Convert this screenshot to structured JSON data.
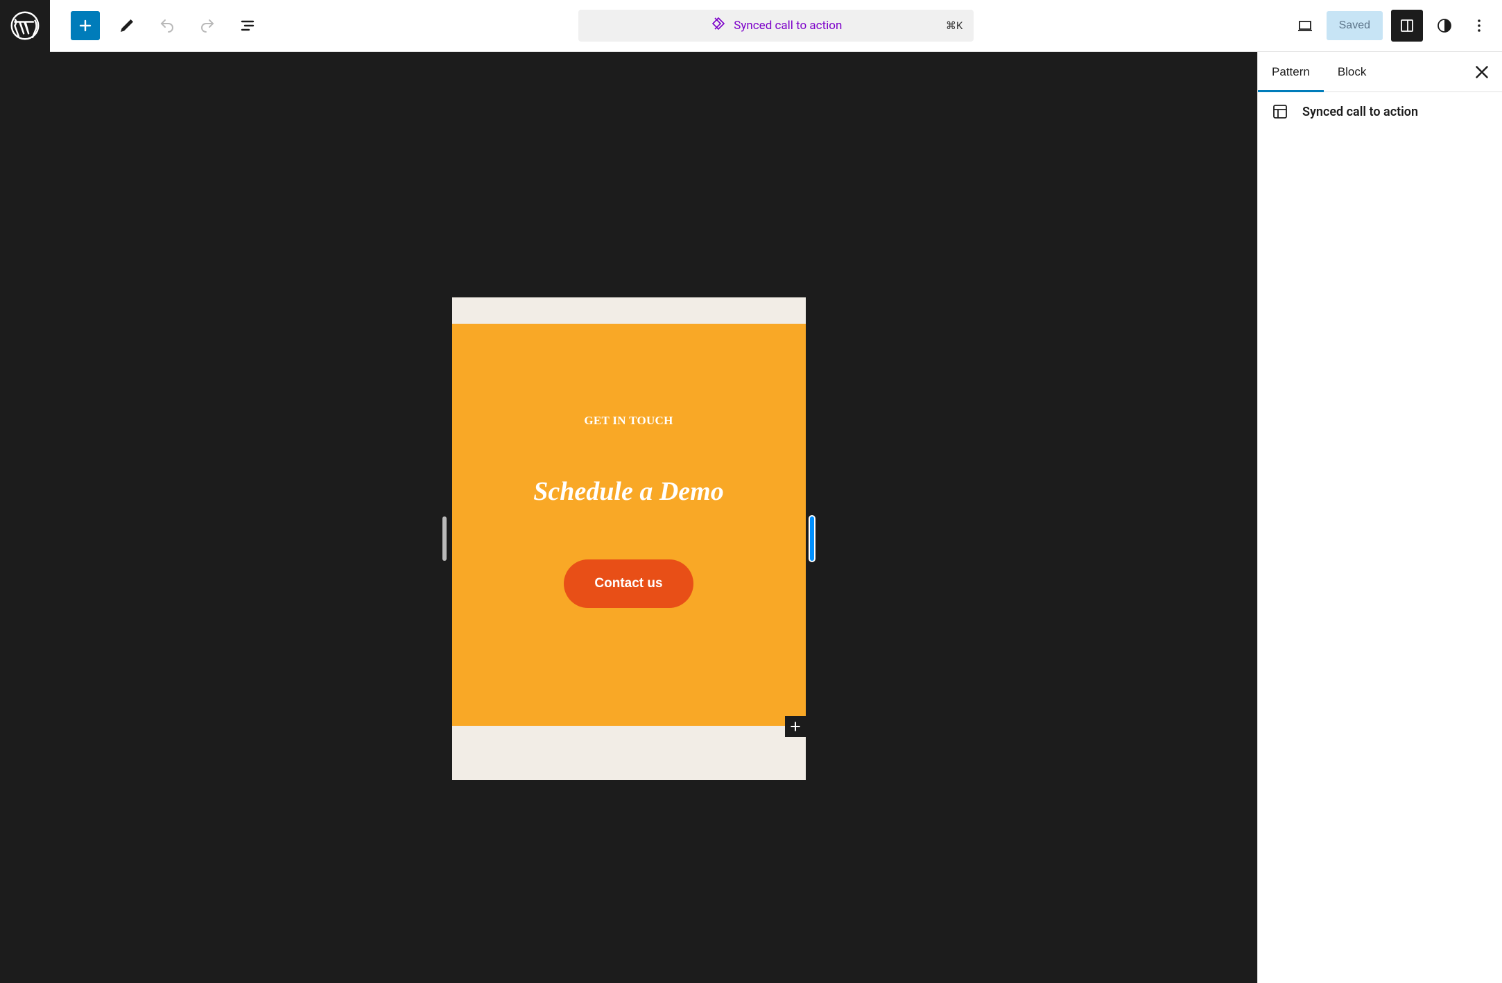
{
  "toolbar": {
    "document_title": "Synced call to action",
    "shortcut": "⌘K",
    "saved_label": "Saved"
  },
  "canvas": {
    "cta": {
      "eyebrow": "GET IN TOUCH",
      "heading": "Schedule a Demo",
      "button_label": "Contact us"
    }
  },
  "sidebar": {
    "tabs": {
      "pattern": "Pattern",
      "block": "Block"
    },
    "pattern_name": "Synced call to action"
  }
}
